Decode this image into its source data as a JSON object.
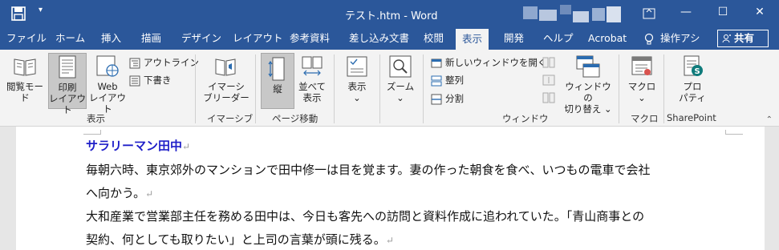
{
  "titlebar": {
    "doc_title": "テスト.htm  -  Word",
    "minimize": "—",
    "restore": "☐",
    "close": "✕",
    "restore2": "⧉"
  },
  "tabs": [
    "ファイル",
    "ホーム",
    "挿入",
    "描画",
    "デザイン",
    "レイアウト",
    "参考資料",
    "差し込み文書",
    "校閲",
    "表示",
    "開発",
    "ヘルプ",
    "Acrobat"
  ],
  "active_tab": "表示",
  "tell_me": "操作アシ",
  "share": "共有",
  "ribbon": {
    "views": {
      "read_mode": "閲覧モード",
      "print_layout_1": "印刷",
      "print_layout_2": "レイアウト",
      "web_layout_1": "Web",
      "web_layout_2": "レイアウト",
      "outline": "アウトライン",
      "draft": "下書き",
      "group": "表示"
    },
    "immersive": {
      "reader_1": "イマーシ",
      "reader_2": "ブリーダー",
      "group": "イマーシブ"
    },
    "page_move": {
      "vertical": "縦",
      "side_1": "並べて",
      "side_2": "表示",
      "group": "ページ移動"
    },
    "show": {
      "label": "表示",
      "chevron": "⌄"
    },
    "zoom": {
      "label": "ズーム",
      "chevron": "⌄"
    },
    "window": {
      "new_window": "新しいウィンドウを開く",
      "arrange_all": "整列",
      "split": "分割",
      "switch_1": "ウィンドウの",
      "switch_2": "切り替え",
      "chevron": "⌄",
      "group": "ウィンドウ"
    },
    "macros": {
      "label": "マクロ",
      "chevron": "⌄",
      "group": "マクロ"
    },
    "sharepoint": {
      "label_1": "プロ",
      "label_2": "パティ",
      "group": "SharePoint"
    }
  },
  "document": {
    "heading": "サラリーマン田中",
    "lines": [
      "毎朝六時、東京郊外のマンションで田中修一は目を覚ます。妻の作った朝食を食べ、いつもの電車で会社",
      "へ向かう。",
      "大和産業で営業部主任を務める田中は、今日も客先への訪問と資料作成に追われていた。「青山商事との",
      "契約、何としても取りたい」と上司の言葉が頭に残る。"
    ],
    "para_mark": "↵"
  }
}
